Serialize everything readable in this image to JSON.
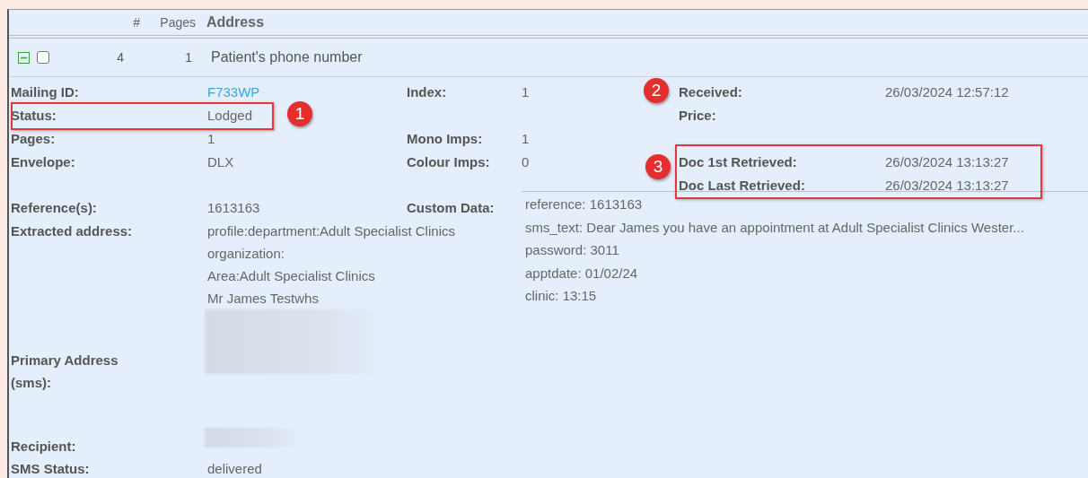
{
  "table": {
    "columns": [
      "#",
      "Pages",
      "Address"
    ],
    "rows": [
      {
        "expanded": true,
        "checked": false,
        "number": "4",
        "pages": "1",
        "address": "Patient's phone number",
        "summary_rows": [
          [
            {
              "label": "Mailing ID:",
              "value": "F733WP",
              "link": true
            },
            {
              "label": "Index:",
              "value": "1"
            },
            {
              "label": "Received:",
              "value": "26/03/2024 12:57:12"
            }
          ],
          [
            {
              "label": "Status:",
              "value": "Lodged"
            },
            null,
            {
              "label": "Price:"
            }
          ],
          [
            {
              "label": "Pages:",
              "value": "1"
            },
            {
              "label": "Mono Imps:",
              "value": "1"
            },
            null
          ],
          [
            {
              "label": "Envelope:",
              "value": "DLX"
            },
            {
              "label": "Colour Imps:",
              "value": "0"
            },
            {
              "label": "Doc 1st Retrieved:",
              "value": "26/03/2024 13:13:27"
            }
          ],
          [
            null,
            null,
            {
              "label": "Doc Last Retrieved:",
              "value": "26/03/2024 13:13:27"
            }
          ]
        ],
        "reference": {
          "label": "Reference(s):",
          "value": "1613163"
        },
        "extracted_address": {
          "label": "Extracted address:",
          "lines": [
            "profile:department:Adult Specialist Clinics",
            "organization:",
            "Area:Adult Specialist Clinics",
            "Mr James Testwhs"
          ]
        },
        "custom_data": {
          "label": "Custom Data:",
          "lines": [
            "reference: 1613163",
            "sms_text: Dear James you have an appointment at Adult Specialist Clinics Wester...",
            "password: 3011",
            "apptdate: 01/02/24",
            "clinic: 13:15"
          ]
        },
        "primary_address": {
          "label": "Primary Address (sms):",
          "kind": "redacted"
        },
        "recipient": {
          "label": "Recipient:",
          "kind": "redacted"
        },
        "sms_status": {
          "label": "SMS Status:",
          "value": "delivered"
        }
      }
    ]
  },
  "annotations": [
    {
      "label": "1"
    },
    {
      "label": "2"
    },
    {
      "label": "3"
    }
  ]
}
